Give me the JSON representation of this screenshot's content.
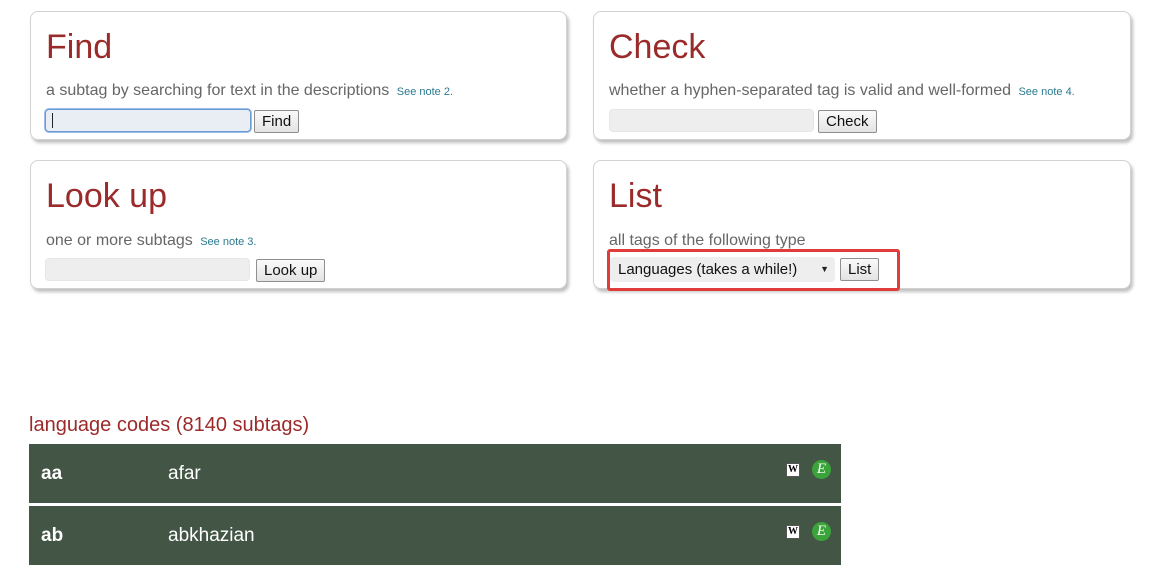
{
  "find": {
    "title": "Find",
    "description": "a subtag by searching for text in the descriptions",
    "note": "See note 2.",
    "input_value": "",
    "button": "Find"
  },
  "check": {
    "title": "Check",
    "description": "whether a hyphen-separated tag is valid and well-formed",
    "note": "See note 4.",
    "input_value": "",
    "button": "Check"
  },
  "lookup": {
    "title": "Look up",
    "description": "one or more subtags",
    "note": "See note 3.",
    "input_value": "",
    "button": "Look up"
  },
  "list": {
    "title": "List",
    "description": "all tags of the following type",
    "select_value": "Languages (takes a while!)",
    "button": "List",
    "highlight_color": "#e03c3c"
  },
  "results": {
    "heading": "language codes (8140 subtags)",
    "row_color": "#435545",
    "rows": [
      {
        "code": "aa",
        "name": "afar",
        "icons": [
          "wikipedia-icon",
          "ethnologue-icon"
        ]
      },
      {
        "code": "ab",
        "name": "abkhazian",
        "icons": [
          "wikipedia-icon",
          "ethnologue-icon"
        ]
      }
    ],
    "wiki_glyph": "W",
    "eth_glyph": "E"
  },
  "colors": {
    "title": "#9b2a2a",
    "link": "#2a7a90"
  }
}
